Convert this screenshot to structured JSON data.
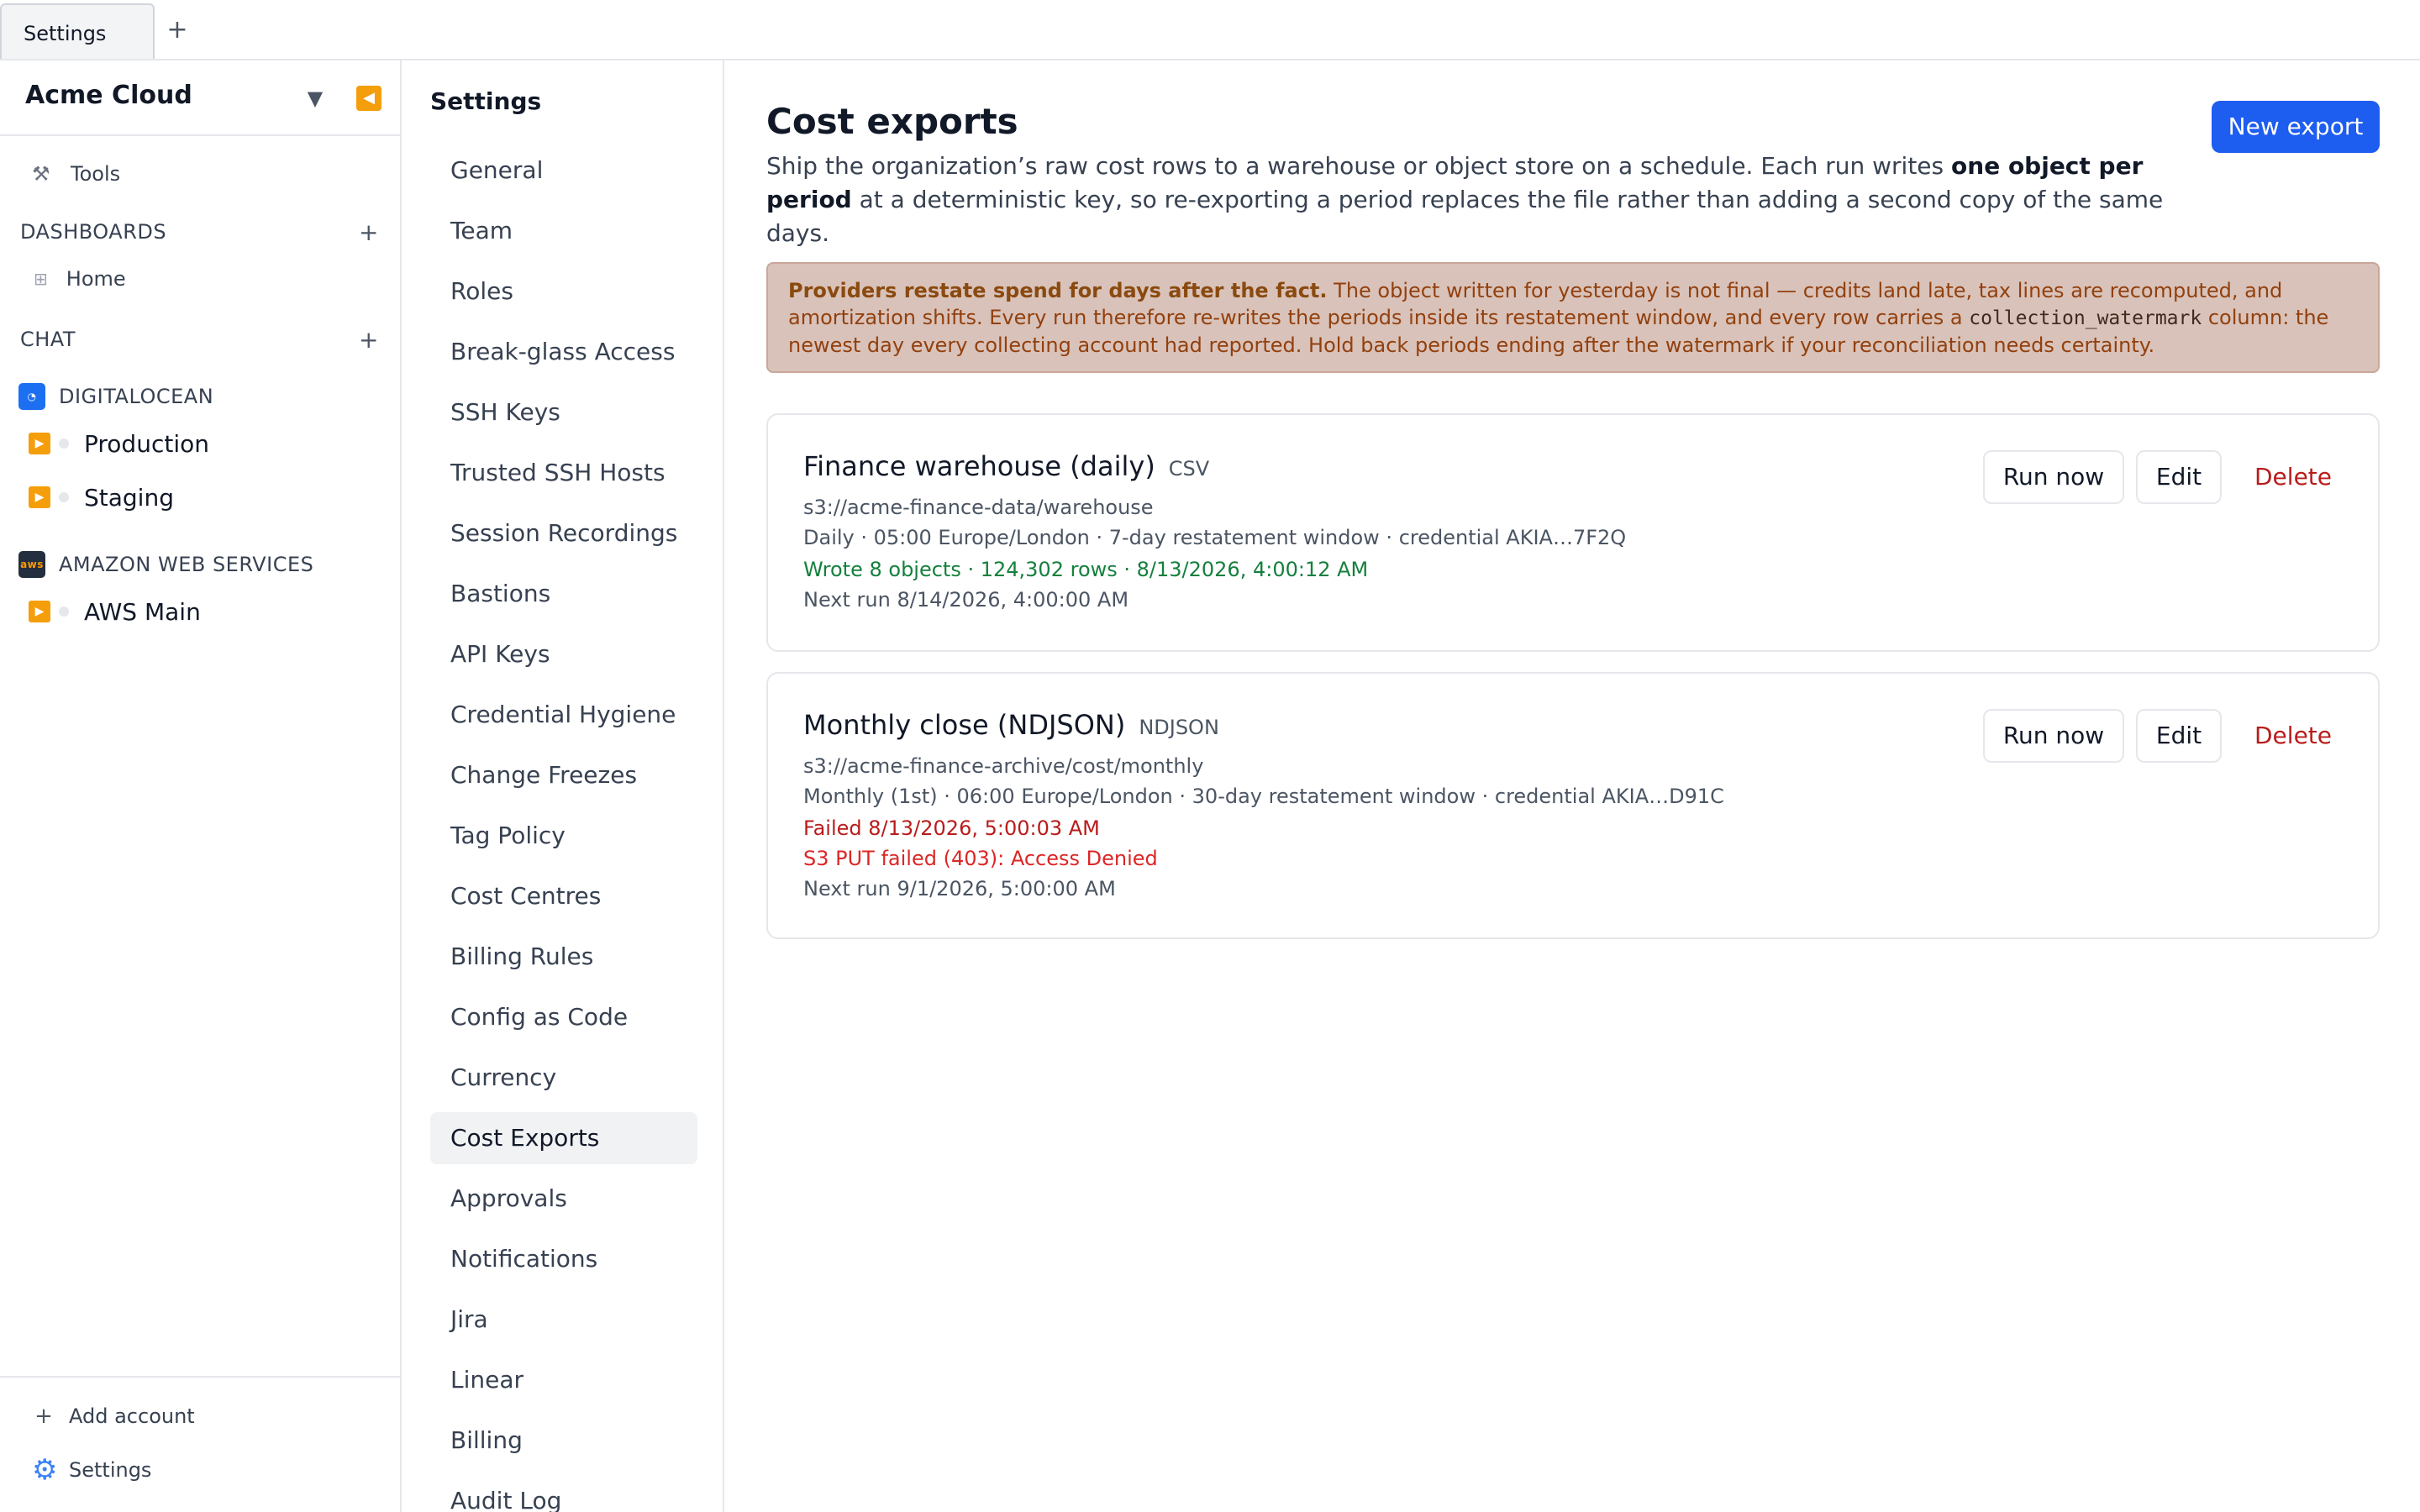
{
  "tabs": [
    {
      "label": "Settings"
    }
  ],
  "sidebar": {
    "org_name": "Acme Cloud",
    "tools_label": "Tools",
    "dashboards_label": "DASHBOARDS",
    "home_label": "Home",
    "chat_label": "CHAT",
    "providers": [
      {
        "name": "DIGITALOCEAN",
        "accounts": [
          "Production",
          "Staging"
        ]
      },
      {
        "name": "AMAZON WEB SERVICES",
        "logo_text": "aws",
        "accounts": [
          "AWS Main"
        ]
      }
    ],
    "add_account_label": "Add account",
    "settings_label": "Settings"
  },
  "settings_nav": {
    "title": "Settings",
    "items": [
      "General",
      "Team",
      "Roles",
      "Break-glass Access",
      "SSH Keys",
      "Trusted SSH Hosts",
      "Session Recordings",
      "Bastions",
      "API Keys",
      "Credential Hygiene",
      "Change Freezes",
      "Tag Policy",
      "Cost Centres",
      "Billing Rules",
      "Config as Code",
      "Currency",
      "Cost Exports",
      "Approvals",
      "Notifications",
      "Jira",
      "Linear",
      "Billing",
      "Audit Log"
    ],
    "active": "Cost Exports"
  },
  "main": {
    "title": "Cost exports",
    "new_export_label": "New export",
    "description_pre": "Ship the organization’s raw cost rows to a warehouse or object store on a schedule. Each run writes ",
    "description_bold": "one object per period",
    "description_post": " at a deterministic key, so re-exporting a period replaces the file rather than adding a second copy of the same days.",
    "warning_bold": "Providers restate spend for days after the fact.",
    "warning_text_1": " The object written for yesterday is not final — credits land late, tax lines are recomputed, and amortization shifts. Every run therefore re-writes the periods inside its restatement window, and every row carries a ",
    "warning_code": "collection_watermark",
    "warning_text_2": " column: the newest day every collecting account had reported. Hold back periods ending after the watermark if your reconciliation needs certainty.",
    "exports": [
      {
        "name": "Finance warehouse (daily)",
        "format": "CSV",
        "destination": "s3://acme-finance-data/warehouse",
        "schedule": "Daily · 05:00 Europe/London · 7-day restatement window · credential AKIA…7F2Q",
        "status": "Wrote 8 objects · 124,302 rows · 8/13/2026, 4:00:12 AM",
        "status_kind": "success",
        "next_run": "Next run 8/14/2026, 4:00:00 AM"
      },
      {
        "name": "Monthly close (NDJSON)",
        "format": "NDJSON",
        "destination": "s3://acme-finance-archive/cost/monthly",
        "schedule": "Monthly (1st) · 06:00 Europe/London · 30-day restatement window · credential AKIA…D91C",
        "status": "Failed 8/13/2026, 5:00:03 AM",
        "status_kind": "failed",
        "error": "S3 PUT failed (403): Access Denied",
        "next_run": "Next run 9/1/2026, 5:00:00 AM"
      }
    ],
    "run_now_label": "Run now",
    "edit_label": "Edit",
    "delete_label": "Delete"
  },
  "colors": {
    "accent": "#1d5df0",
    "warning_bg": "#d9c2b9",
    "success": "#15803d",
    "danger": "#b91c1c",
    "provider_icon": "#f59e0b"
  },
  "icons": {
    "tab_add": "plus-icon",
    "org_caret": "triangle-down-icon",
    "collapse": "collapse-left-icon",
    "tools": "tools-icon",
    "home": "grid-icon",
    "account": "play-icon",
    "add_account": "plus-icon",
    "settings": "gear-icon"
  }
}
